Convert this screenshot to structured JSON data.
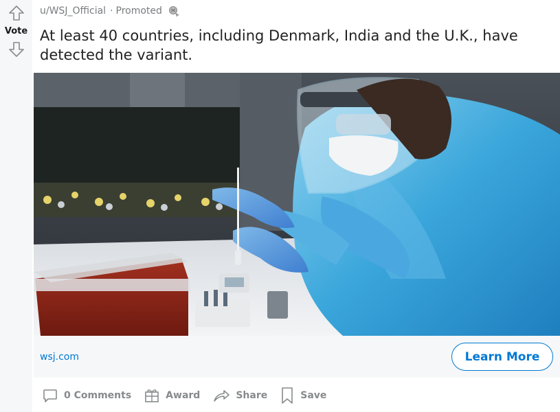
{
  "vote": {
    "label": "Vote"
  },
  "post": {
    "author": "u/WSJ_Official",
    "separator": "·",
    "promoted_label": "Promoted",
    "title": "At least 40 countries, including Denmark, India and the U.K., have detected the variant."
  },
  "cta": {
    "domain": "wsj.com",
    "button_label": "Learn More"
  },
  "actions": {
    "comments_label": "0 Comments",
    "award_label": "Award",
    "share_label": "Share",
    "save_label": "Save"
  },
  "colors": {
    "accent": "#0079d3",
    "rail_bg": "#f6f7f8",
    "muted": "#878a8c"
  },
  "icons": [
    "upvote-arrow-icon",
    "downvote-arrow-icon",
    "award-badge-icon",
    "comment-icon",
    "gift-award-icon",
    "share-arrow-icon",
    "bookmark-icon"
  ]
}
